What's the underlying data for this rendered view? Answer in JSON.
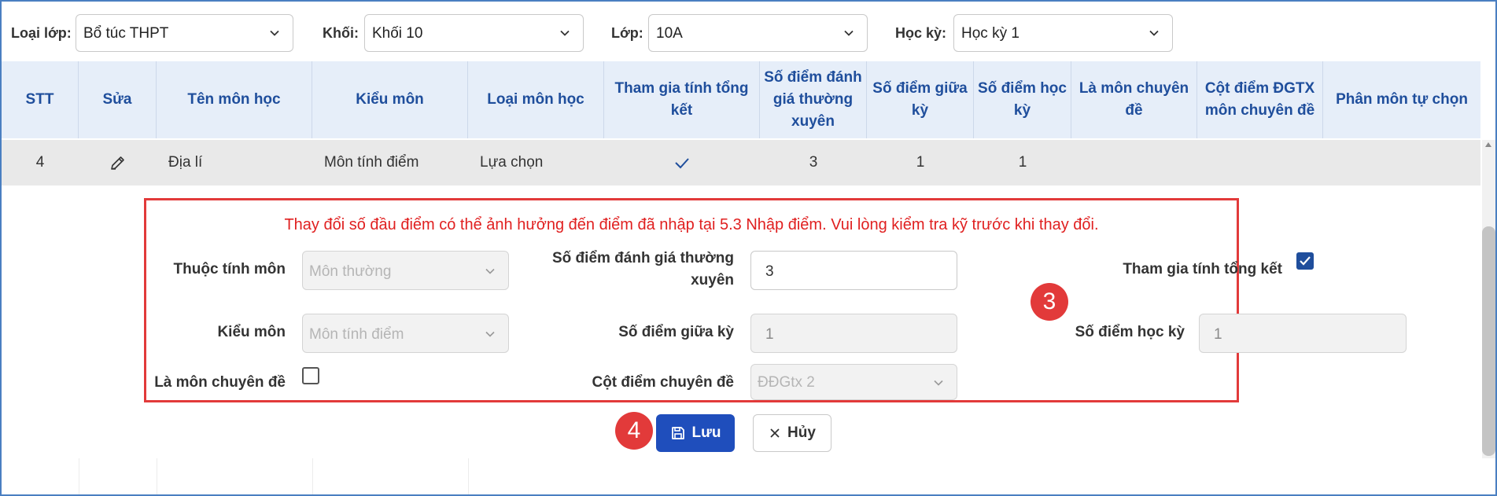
{
  "filters": {
    "class_type": {
      "label": "Loại lớp:",
      "value": "Bổ túc THPT"
    },
    "grade": {
      "label": "Khối:",
      "value": "Khối 10"
    },
    "class": {
      "label": "Lớp:",
      "value": "10A"
    },
    "semester": {
      "label": "Học kỳ:",
      "value": "Học kỳ 1"
    }
  },
  "table": {
    "columns": [
      "STT",
      "Sửa",
      "Tên môn học",
      "Kiểu môn",
      "Loại môn học",
      "Tham gia tính tổng kết",
      "Số điểm đánh giá thường xuyên",
      "Số điểm giữa kỳ",
      "Số điểm học kỳ",
      "Là môn chuyên đề",
      "Cột điểm ĐGTX môn chuyên đề",
      "Phân môn tự chọn"
    ],
    "row": {
      "stt": "4",
      "name": "Địa lí",
      "type": "Môn tính điểm",
      "category": "Lựa chọn",
      "in_summary": true,
      "regular_scores": "3",
      "midterm_scores": "1",
      "semester_scores": "1"
    }
  },
  "edit_panel": {
    "warning": "Thay đổi số đầu điểm có thể ảnh hưởng đến điểm đã nhập tại 5.3 Nhập điểm. Vui lòng kiểm tra kỹ trước khi thay đổi.",
    "subject_attr": {
      "label": "Thuộc tính môn",
      "placeholder": "Môn thường"
    },
    "subject_type": {
      "label": "Kiểu môn",
      "placeholder": "Môn tính điểm"
    },
    "is_topic": {
      "label": "Là môn chuyên đề",
      "checked": false
    },
    "regular_scores": {
      "label": "Số điểm đánh giá thường xuyên",
      "value": "3"
    },
    "midterm_scores": {
      "label": "Số điểm giữa kỳ",
      "value": "1"
    },
    "topic_column": {
      "label": "Cột điểm chuyên đề",
      "placeholder": "ĐĐGtx 2"
    },
    "in_summary": {
      "label": "Tham gia tính tổng kết",
      "checked": true
    },
    "semester_scores": {
      "label": "Số điểm học kỳ",
      "value": "1"
    }
  },
  "buttons": {
    "save": "Lưu",
    "cancel": "Hủy"
  },
  "badges": {
    "panel": "3",
    "save": "4"
  },
  "colors": {
    "primary": "#1f4ebc",
    "header_text": "#1f4e9c",
    "header_bg": "#e6eef9",
    "warning": "#e02020",
    "badge": "#e23a3a"
  },
  "icons": {
    "edit": "pencil-icon",
    "check": "check-icon",
    "save": "floppy-disk-icon",
    "cancel": "close-icon",
    "dropdown": "chevron-down-icon"
  }
}
